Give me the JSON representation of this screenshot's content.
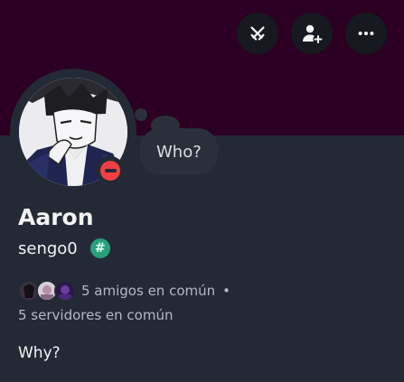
{
  "banner": {
    "color": "#2c0022",
    "actions": [
      {
        "icon": "crossed-swords-icon",
        "label": ""
      },
      {
        "icon": "add-friend-icon",
        "label": ""
      },
      {
        "icon": "more-options-icon",
        "label": ""
      }
    ]
  },
  "profile": {
    "status": "do-not-disturb",
    "status_color": "#f23f43",
    "custom_status": "Who?",
    "display_name": "Aaron",
    "username": "sengo0",
    "badge_symbol": "#",
    "badge_color": "#26a17b"
  },
  "mutual": {
    "friends": "5 amigos en común",
    "separator": "•",
    "servers": "5 servidores en común"
  },
  "bio": "Why?"
}
